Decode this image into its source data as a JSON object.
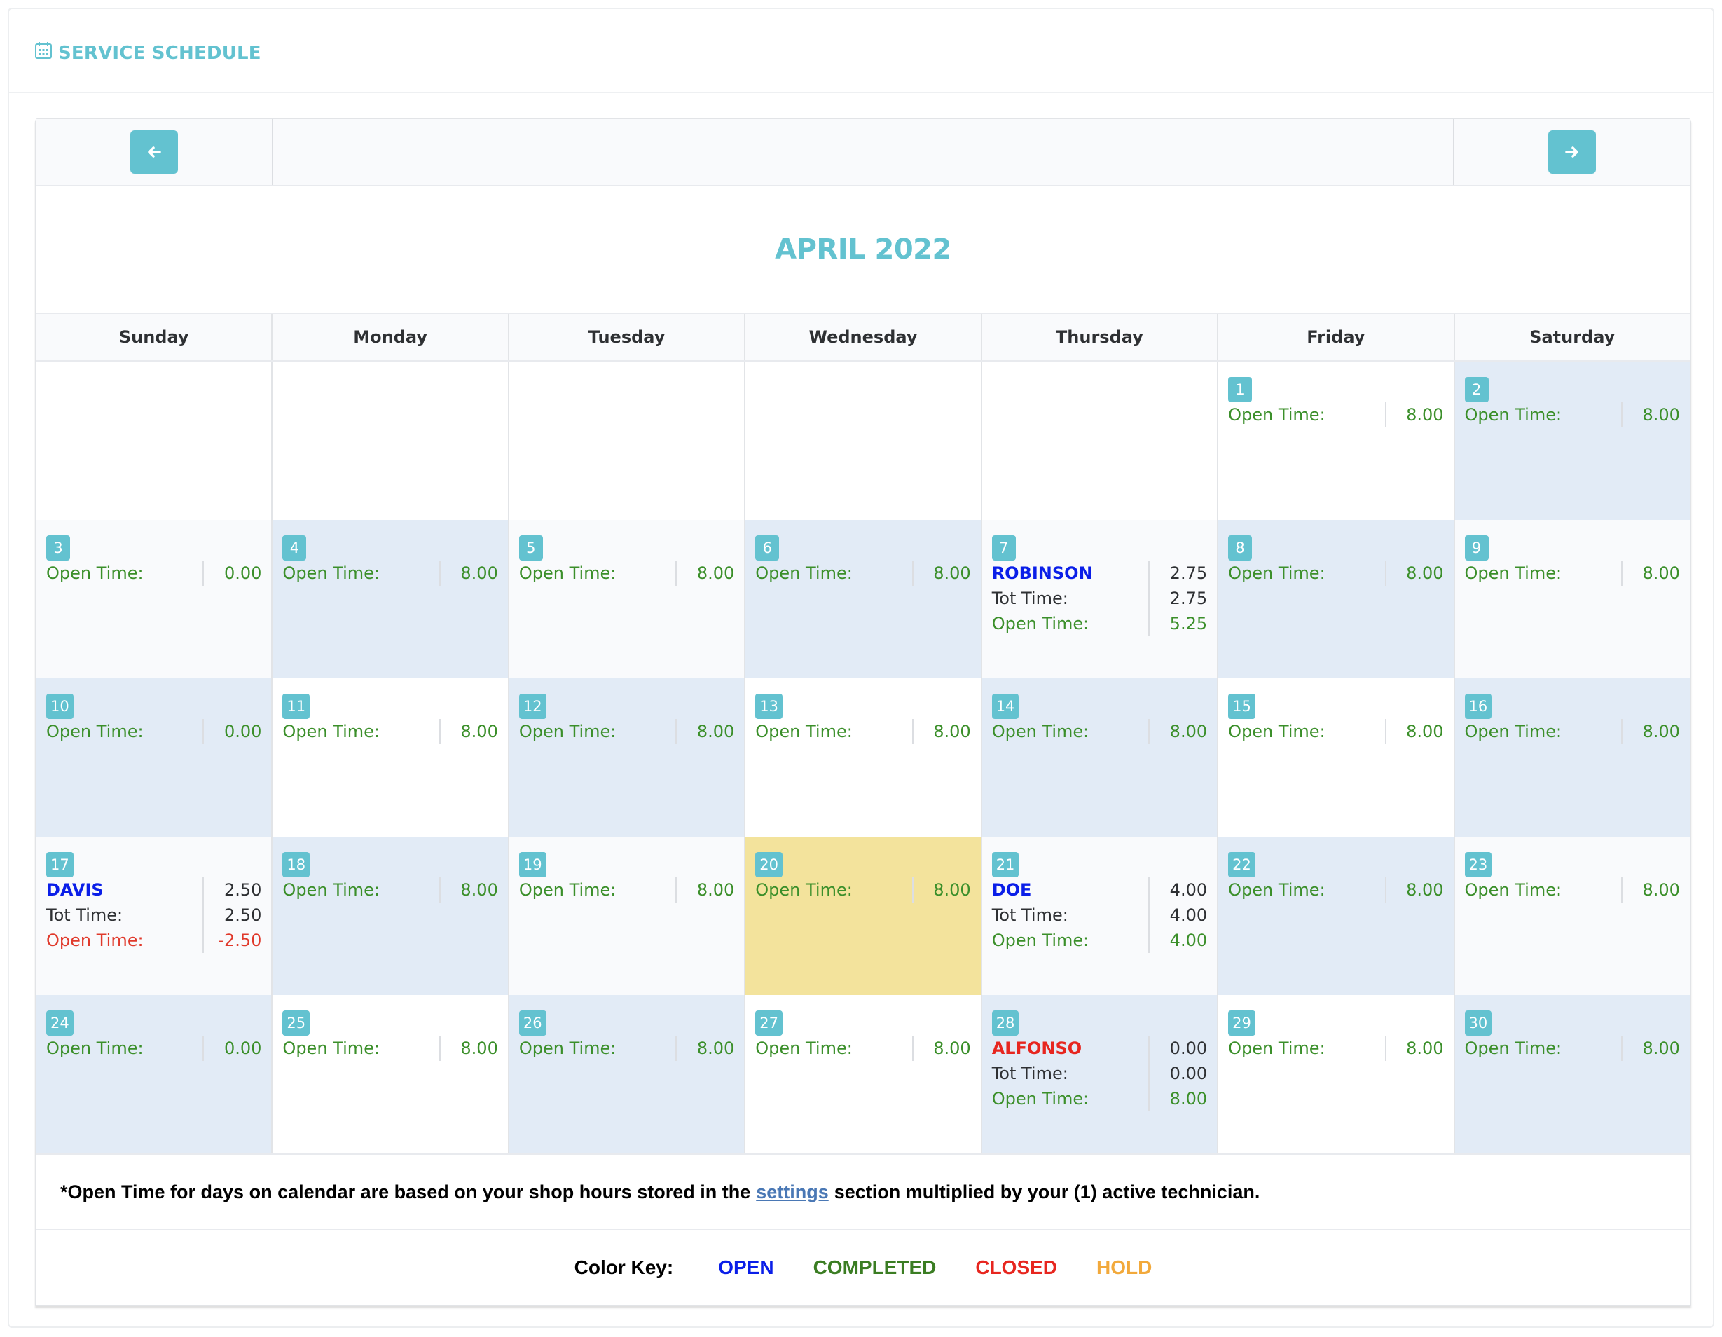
{
  "header": {
    "title": "SERVICE SCHEDULE",
    "icon": "calendar-icon"
  },
  "nav": {
    "prev_icon": "arrow-left-icon",
    "next_icon": "arrow-right-icon"
  },
  "month_title": "APRIL 2022",
  "days_of_week": [
    "Sunday",
    "Monday",
    "Tuesday",
    "Wednesday",
    "Thursday",
    "Friday",
    "Saturday"
  ],
  "weeks": [
    [
      {
        "bg": "white"
      },
      {
        "bg": "white"
      },
      {
        "bg": "white"
      },
      {
        "bg": "white"
      },
      {
        "bg": "white"
      },
      {
        "day": "1",
        "bg": "white",
        "lines": [
          {
            "label": "Open Time:",
            "value": "8.00",
            "style": "green"
          }
        ]
      },
      {
        "day": "2",
        "bg": "blue",
        "lines": [
          {
            "label": "Open Time:",
            "value": "8.00",
            "style": "green"
          }
        ]
      }
    ],
    [
      {
        "day": "3",
        "bg": "light",
        "lines": [
          {
            "label": "Open Time:",
            "value": "0.00",
            "style": "green"
          }
        ]
      },
      {
        "day": "4",
        "bg": "blue",
        "lines": [
          {
            "label": "Open Time:",
            "value": "8.00",
            "style": "green"
          }
        ]
      },
      {
        "day": "5",
        "bg": "light",
        "lines": [
          {
            "label": "Open Time:",
            "value": "8.00",
            "style": "green"
          }
        ]
      },
      {
        "day": "6",
        "bg": "blue",
        "lines": [
          {
            "label": "Open Time:",
            "value": "8.00",
            "style": "green"
          }
        ]
      },
      {
        "day": "7",
        "bg": "light",
        "lines": [
          {
            "label": "ROBINSON",
            "value": "2.75",
            "style": "tech-open"
          },
          {
            "label": "Tot Time:",
            "value": "2.75",
            "style": "dark"
          },
          {
            "label": "Open Time:",
            "value": "5.25",
            "style": "green"
          }
        ]
      },
      {
        "day": "8",
        "bg": "blue",
        "lines": [
          {
            "label": "Open Time:",
            "value": "8.00",
            "style": "green"
          }
        ]
      },
      {
        "day": "9",
        "bg": "light",
        "lines": [
          {
            "label": "Open Time:",
            "value": "8.00",
            "style": "green"
          }
        ]
      }
    ],
    [
      {
        "day": "10",
        "bg": "blue",
        "lines": [
          {
            "label": "Open Time:",
            "value": "0.00",
            "style": "green"
          }
        ]
      },
      {
        "day": "11",
        "bg": "white",
        "lines": [
          {
            "label": "Open Time:",
            "value": "8.00",
            "style": "green"
          }
        ]
      },
      {
        "day": "12",
        "bg": "blue",
        "lines": [
          {
            "label": "Open Time:",
            "value": "8.00",
            "style": "green"
          }
        ]
      },
      {
        "day": "13",
        "bg": "white",
        "lines": [
          {
            "label": "Open Time:",
            "value": "8.00",
            "style": "green"
          }
        ]
      },
      {
        "day": "14",
        "bg": "blue",
        "lines": [
          {
            "label": "Open Time:",
            "value": "8.00",
            "style": "green"
          }
        ]
      },
      {
        "day": "15",
        "bg": "white",
        "lines": [
          {
            "label": "Open Time:",
            "value": "8.00",
            "style": "green"
          }
        ]
      },
      {
        "day": "16",
        "bg": "blue",
        "lines": [
          {
            "label": "Open Time:",
            "value": "8.00",
            "style": "green"
          }
        ]
      }
    ],
    [
      {
        "day": "17",
        "bg": "light",
        "lines": [
          {
            "label": "DAVIS",
            "value": "2.50",
            "style": "tech-open"
          },
          {
            "label": "Tot Time:",
            "value": "2.50",
            "style": "dark"
          },
          {
            "label": "Open Time:",
            "value": "-2.50",
            "style": "red"
          }
        ]
      },
      {
        "day": "18",
        "bg": "blue",
        "lines": [
          {
            "label": "Open Time:",
            "value": "8.00",
            "style": "green"
          }
        ]
      },
      {
        "day": "19",
        "bg": "light",
        "lines": [
          {
            "label": "Open Time:",
            "value": "8.00",
            "style": "green"
          }
        ]
      },
      {
        "day": "20",
        "bg": "yellow",
        "today": true,
        "lines": [
          {
            "label": "Open Time:",
            "value": "8.00",
            "style": "green"
          }
        ]
      },
      {
        "day": "21",
        "bg": "light",
        "lines": [
          {
            "label": "DOE",
            "value": "4.00",
            "style": "tech-open"
          },
          {
            "label": "Tot Time:",
            "value": "4.00",
            "style": "dark"
          },
          {
            "label": "Open Time:",
            "value": "4.00",
            "style": "green"
          }
        ]
      },
      {
        "day": "22",
        "bg": "blue",
        "lines": [
          {
            "label": "Open Time:",
            "value": "8.00",
            "style": "green"
          }
        ]
      },
      {
        "day": "23",
        "bg": "light",
        "lines": [
          {
            "label": "Open Time:",
            "value": "8.00",
            "style": "green"
          }
        ]
      }
    ],
    [
      {
        "day": "24",
        "bg": "blue",
        "lines": [
          {
            "label": "Open Time:",
            "value": "0.00",
            "style": "green"
          }
        ]
      },
      {
        "day": "25",
        "bg": "white",
        "lines": [
          {
            "label": "Open Time:",
            "value": "8.00",
            "style": "green"
          }
        ]
      },
      {
        "day": "26",
        "bg": "blue",
        "lines": [
          {
            "label": "Open Time:",
            "value": "8.00",
            "style": "green"
          }
        ]
      },
      {
        "day": "27",
        "bg": "white",
        "lines": [
          {
            "label": "Open Time:",
            "value": "8.00",
            "style": "green"
          }
        ]
      },
      {
        "day": "28",
        "bg": "blue",
        "lines": [
          {
            "label": "ALFONSO",
            "value": "0.00",
            "style": "tech-closed"
          },
          {
            "label": "Tot Time:",
            "value": "0.00",
            "style": "dark"
          },
          {
            "label": "Open Time:",
            "value": "8.00",
            "style": "green"
          }
        ]
      },
      {
        "day": "29",
        "bg": "white",
        "lines": [
          {
            "label": "Open Time:",
            "value": "8.00",
            "style": "green"
          }
        ]
      },
      {
        "day": "30",
        "bg": "blue",
        "lines": [
          {
            "label": "Open Time:",
            "value": "8.00",
            "style": "green"
          }
        ]
      }
    ]
  ],
  "note": {
    "before": "*Open Time for days on calendar are based on your shop hours stored in the",
    "link": "settings",
    "after": "section multiplied by your (1) active technician."
  },
  "color_key": {
    "label": "Color Key:",
    "items": [
      {
        "label": "OPEN",
        "color": "#0a1ee8"
      },
      {
        "label": "COMPLETED",
        "color": "#3b7d23"
      },
      {
        "label": "CLOSED",
        "color": "#e7261f"
      },
      {
        "label": "HOLD",
        "color": "#f2a93b"
      }
    ]
  }
}
